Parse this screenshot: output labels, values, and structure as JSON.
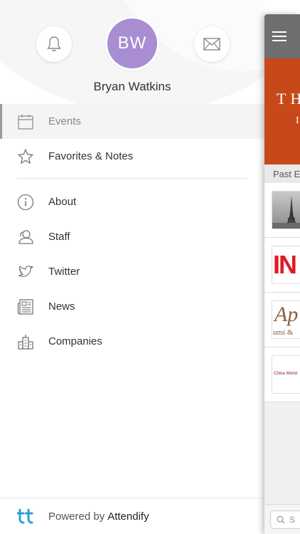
{
  "user": {
    "initials": "BW",
    "name": "Bryan Watkins"
  },
  "menu": {
    "items": [
      {
        "label": "Events",
        "icon": "calendar-icon",
        "active": true
      },
      {
        "label": "Favorites & Notes",
        "icon": "star-icon",
        "active": false
      }
    ],
    "secondary_items": [
      {
        "label": "About",
        "icon": "info-icon"
      },
      {
        "label": "Staff",
        "icon": "staff-icon"
      },
      {
        "label": "Twitter",
        "icon": "twitter-icon"
      },
      {
        "label": "News",
        "icon": "newspaper-icon"
      },
      {
        "label": "Companies",
        "icon": "buildings-icon"
      }
    ]
  },
  "footer": {
    "powered_by": "Powered by",
    "brand": "Attendify"
  },
  "main": {
    "banner_line1": "TH",
    "banner_line2": "I",
    "section_title": "Past E",
    "event_thumbs": [
      {
        "icon": "eiffel-tower-thumb"
      },
      {
        "text": "IN"
      },
      {
        "text": "Ap",
        "subtext": "umi &"
      },
      {
        "text": "China World"
      }
    ],
    "search_placeholder": "S"
  },
  "colors": {
    "avatar": "#a88dd3",
    "banner": "#c7491a",
    "nav": "#6f6f6f",
    "logo": "#2a9fd8"
  }
}
